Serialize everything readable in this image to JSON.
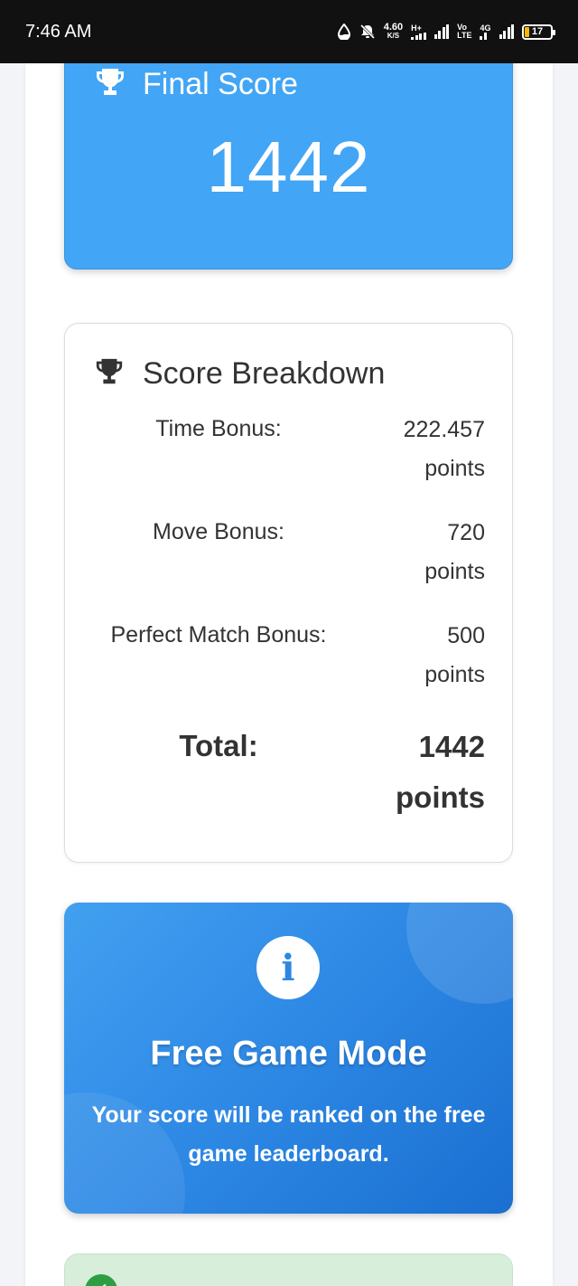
{
  "status_bar": {
    "time": "7:46 AM",
    "net_speed_value": "4.60",
    "net_speed_unit": "K/S",
    "signal1_label": "H+",
    "volte_top": "Vo",
    "volte_bottom": "LTE",
    "signal2_label": "4G",
    "battery_level": "17"
  },
  "final_score": {
    "title": "Final Score",
    "value": "1442",
    "icon": "trophy-icon"
  },
  "breakdown": {
    "title": "Score Breakdown",
    "icon": "trophy-icon",
    "rows": [
      {
        "label": "Time Bonus:",
        "value": "222.457",
        "unit": "points"
      },
      {
        "label": "Move Bonus:",
        "value": "720",
        "unit": "points"
      },
      {
        "label": "Perfect Match Bonus:",
        "value": "500",
        "unit": "points"
      }
    ],
    "total": {
      "label": "Total:",
      "value": "1442",
      "unit": "points"
    }
  },
  "info": {
    "icon": "info-icon",
    "icon_glyph": "i",
    "title": "Free Game Mode",
    "text": "Your score will be ranked on the free game leaderboard."
  },
  "success_card": {
    "icon": "check-circle-icon",
    "icon_glyph": "✓"
  },
  "colors": {
    "primary_blue": "#42a5f5",
    "info_gradient_dark": "#1a6fd0",
    "success_bg": "#d7eedb",
    "success_icon": "#2e9e44",
    "text_dark": "#333333"
  }
}
